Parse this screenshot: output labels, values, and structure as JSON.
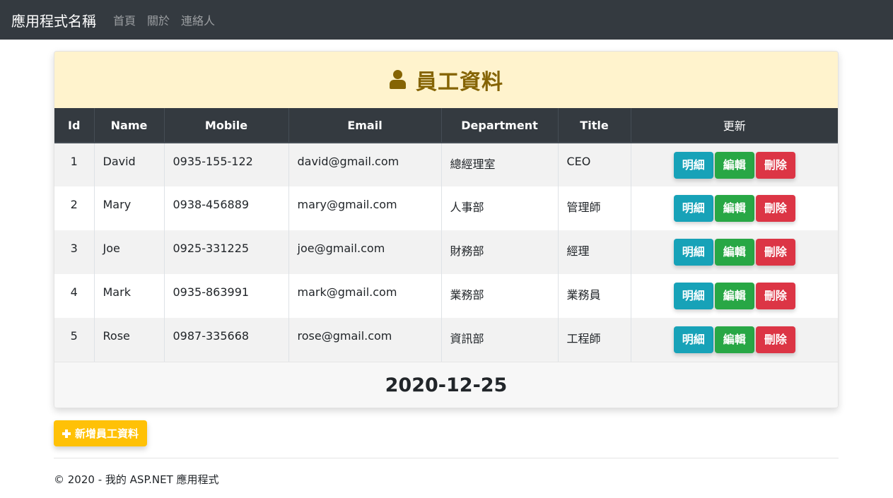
{
  "navbar": {
    "brand": "應用程式名稱",
    "links": [
      "首頁",
      "關於",
      "連絡人"
    ]
  },
  "card": {
    "title": "員工資料",
    "title_icon": "user-icon",
    "columns": [
      "Id",
      "Name",
      "Mobile",
      "Email",
      "Department",
      "Title",
      "更新"
    ],
    "rows": [
      {
        "id": "1",
        "name": "David",
        "mobile": "0935-155-122",
        "email": "david@gmail.com",
        "department": "總經理室",
        "title": "CEO"
      },
      {
        "id": "2",
        "name": "Mary",
        "mobile": "0938-456889",
        "email": "mary@gmail.com",
        "department": "人事部",
        "title": "管理師"
      },
      {
        "id": "3",
        "name": "Joe",
        "mobile": "0925-331225",
        "email": "joe@gmail.com",
        "department": "財務部",
        "title": "經理"
      },
      {
        "id": "4",
        "name": "Mark",
        "mobile": "0935-863991",
        "email": "mark@gmail.com",
        "department": "業務部",
        "title": "業務員"
      },
      {
        "id": "5",
        "name": "Rose",
        "mobile": "0987-335668",
        "email": "rose@gmail.com",
        "department": "資訊部",
        "title": "工程師"
      }
    ],
    "actions": {
      "details": "明細",
      "edit": "編輯",
      "delete": "刪除"
    },
    "footer_date": "2020-12-25"
  },
  "add_button": {
    "label": "新增員工資料",
    "icon": "plus-icon"
  },
  "footer": {
    "text": "© 2020 - 我的 ASP.NET 應用程式"
  },
  "colors": {
    "navbar": "#343a40",
    "header_bg": "#fff3cd",
    "header_text": "#856404",
    "info": "#17a2b8",
    "success": "#28a745",
    "danger": "#dc3545",
    "warning": "#ffc107"
  }
}
